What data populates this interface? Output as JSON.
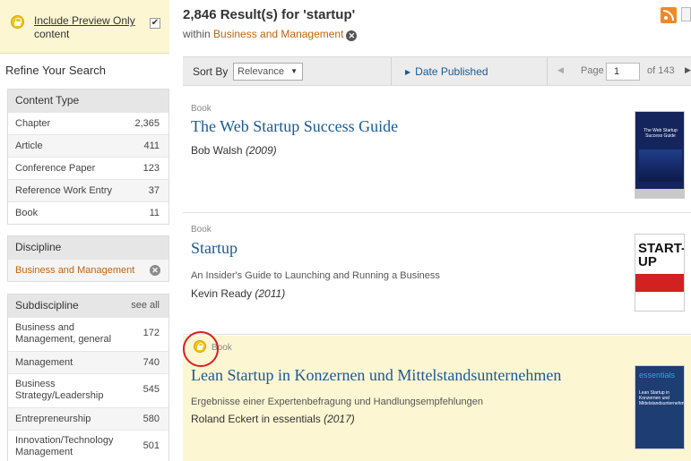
{
  "preview": {
    "label_line1": "Include Preview Only",
    "label_line2": "content",
    "checked_mark": "✔"
  },
  "sidebar": {
    "refine_title": "Refine Your Search",
    "content_type": {
      "title": "Content Type",
      "items": [
        {
          "label": "Chapter",
          "count": "2,365"
        },
        {
          "label": "Article",
          "count": "411"
        },
        {
          "label": "Conference Paper",
          "count": "123"
        },
        {
          "label": "Reference Work Entry",
          "count": "37"
        },
        {
          "label": "Book",
          "count": "11"
        }
      ]
    },
    "discipline": {
      "title": "Discipline",
      "active_item": "Business and Management",
      "remove_glyph": "✕"
    },
    "subdiscipline": {
      "title": "Subdiscipline",
      "see_all": "see all",
      "items": [
        {
          "label_line1": "Business and",
          "label_line2": "Management, general",
          "count": "172"
        },
        {
          "label": "Management",
          "count": "740"
        },
        {
          "label_line1": "Business",
          "label_line2": "Strategy/Leadership",
          "count": "545"
        },
        {
          "label": "Entrepreneurship",
          "count": "580"
        },
        {
          "label_line1": "Innovation/Technology",
          "label_line2": "Management",
          "count": "501"
        }
      ]
    }
  },
  "results_header": {
    "count_text": "2,846 Result(s) for ",
    "query": "'startup'",
    "within_prefix": "within ",
    "within_link": "Business and Management",
    "remove_glyph": "✕"
  },
  "toolbar": {
    "sort_by_label": "Sort By",
    "sort_selected": "Relevance",
    "sort_caret": "▼",
    "date_published": "Date Published",
    "date_tri": "▶",
    "prev_glyph": "◀",
    "page_label": "Page",
    "page_value": "1",
    "of_text": "of 143",
    "next_glyph": "▶"
  },
  "results": [
    {
      "type": "Book",
      "title": "The Web Startup Success Guide",
      "author": "Bob Walsh",
      "year": "(2009)",
      "cover_text": "The Web Startup Success Guide"
    },
    {
      "type": "Book",
      "title": "Startup",
      "subtitle": "An Insider's Guide to Launching and Running a Business",
      "author": "Kevin Ready",
      "year": "(2011)",
      "cover_text": "START-UP"
    },
    {
      "type": "Book",
      "title": "Lean Startup in Konzernen und Mittelstandsunternehmen",
      "subtitle": "Ergebnisse einer Expertenbefragung und Handlungsempfehlungen",
      "author": "Roland Eckert",
      "author_suffix": " in essentials ",
      "year": "(2017)",
      "cover_text": "essentials",
      "cover_sub": "Lean Startup in Konzernen und Mittelstandsunternehmen"
    }
  ],
  "colors": {
    "accent_link": "#1a5a96",
    "orange_link": "#c3640f",
    "preview_bg": "#fdf6d3",
    "highlight_ring": "#d82020"
  },
  "icons": [
    "lock-icon",
    "checkbox-icon",
    "rss-icon",
    "document-icon",
    "remove-icon",
    "caret-down-icon",
    "triangle-right-icon",
    "prev-page-icon",
    "next-page-icon"
  ]
}
